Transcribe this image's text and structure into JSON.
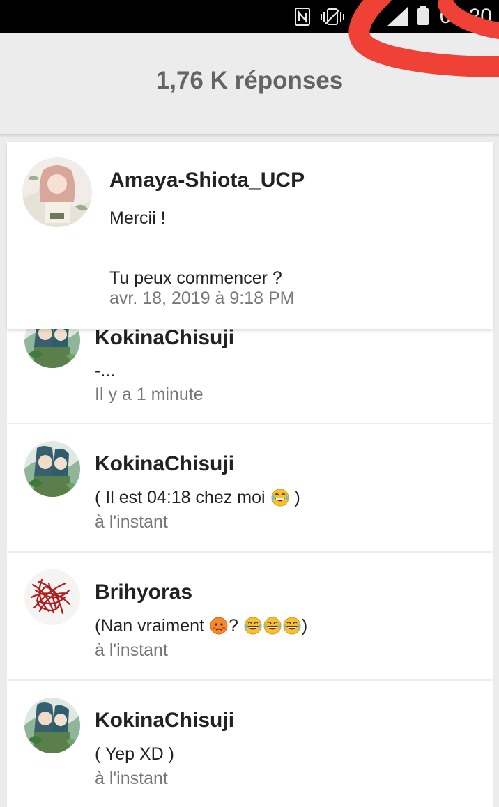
{
  "status_bar": {
    "time": "04:20",
    "icons": [
      "nfc-icon",
      "vibrate-icon",
      "wifi-icon",
      "signal-icon",
      "battery-icon"
    ]
  },
  "header": {
    "title": "1,76 K réponses"
  },
  "pinned_comment": {
    "author": "Amaya-Shiota_UCP",
    "message": "Mercii !\n\nTu peux commencer ?",
    "timestamp": "avr. 18, 2019 à 9:18 PM"
  },
  "replies": [
    {
      "author": "KokinaChisuji",
      "message": "-...",
      "timestamp": "Il y a 1 minute"
    },
    {
      "author": "KokinaChisuji",
      "message": "( Il est 04:18 chez moi ",
      "message_end": " )",
      "emoji": [
        "laughing-tears-emoji"
      ],
      "timestamp": "à l'instant"
    },
    {
      "author": "Brihyoras",
      "message": "(Nan vraiment ",
      "message_mid": "? ",
      "message_end": ")",
      "emoji": [
        "flushed-emoji",
        "laughing-tears-emoji",
        "laughing-tears-emoji",
        "laughing-tears-emoji"
      ],
      "timestamp": "à l'instant"
    },
    {
      "author": "KokinaChisuji",
      "message": "( Yep XD )",
      "timestamp": "à l'instant"
    }
  ],
  "colors": {
    "header_bg": "#ececec",
    "title_text": "#646464",
    "scribble": "#ef4136",
    "timestamp_text": "#777777"
  }
}
